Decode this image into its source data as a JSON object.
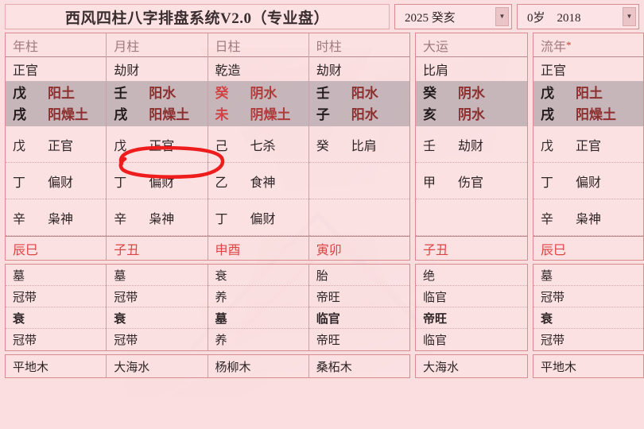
{
  "header": {
    "title": "西风四柱八字排盘系统V2.0（专业盘）",
    "year_select": {
      "value": "2025 癸亥",
      "arrow": "▼"
    },
    "age_select": {
      "value": "0岁　2018",
      "arrow": "▼"
    }
  },
  "colors": {
    "background": "#fbdfe0",
    "panel": "#fce2e3",
    "border": "#d98c90",
    "gz_band": "#b2a5aa",
    "element_text": "#8c2f2f",
    "day_master": "#d04343",
    "void_text": "#dd4444",
    "title_text": "#a07a7d",
    "annotation": "#ee1c1c"
  },
  "pillars": [
    {
      "group": "natal",
      "title": "年柱",
      "title_star": "",
      "ten_god": "正官",
      "stem": {
        "char": "戊",
        "element": "阳土",
        "is_day": false
      },
      "branch": {
        "char": "戌",
        "element": "阳燥土",
        "is_day": false
      },
      "hidden": [
        {
          "char": "戊",
          "god": "正官"
        },
        {
          "char": "丁",
          "god": "偏财"
        },
        {
          "char": "辛",
          "god": "枭神"
        }
      ],
      "void": "辰巳",
      "stages": [
        "墓",
        "冠带",
        "衰",
        "冠带"
      ],
      "stage_bold_index": 2,
      "nayin": "平地木"
    },
    {
      "group": "natal",
      "title": "月柱",
      "title_star": "",
      "ten_god": "劫财",
      "stem": {
        "char": "壬",
        "element": "阳水",
        "is_day": false
      },
      "branch": {
        "char": "戌",
        "element": "阳燥土",
        "is_day": false
      },
      "hidden": [
        {
          "char": "戊",
          "god": "正官"
        },
        {
          "char": "丁",
          "god": "偏财"
        },
        {
          "char": "辛",
          "god": "枭神"
        }
      ],
      "void": "子丑",
      "stages": [
        "墓",
        "冠带",
        "衰",
        "冠带"
      ],
      "stage_bold_index": 2,
      "nayin": "大海水"
    },
    {
      "group": "natal",
      "title": "日柱",
      "title_star": "",
      "ten_god": "乾造",
      "stem": {
        "char": "癸",
        "element": "阴水",
        "is_day": true
      },
      "branch": {
        "char": "未",
        "element": "阴燥土",
        "is_day": true
      },
      "hidden": [
        {
          "char": "己",
          "god": "七杀"
        },
        {
          "char": "乙",
          "god": "食神"
        },
        {
          "char": "丁",
          "god": "偏财"
        }
      ],
      "void": "申酉",
      "stages": [
        "衰",
        "养",
        "墓",
        "养"
      ],
      "stage_bold_index": 2,
      "nayin": "杨柳木"
    },
    {
      "group": "natal",
      "title": "时柱",
      "title_star": "",
      "ten_god": "劫财",
      "stem": {
        "char": "壬",
        "element": "阳水",
        "is_day": false
      },
      "branch": {
        "char": "子",
        "element": "阳水",
        "is_day": false
      },
      "hidden": [
        {
          "char": "癸",
          "god": "比肩"
        },
        {
          "char": "",
          "god": ""
        },
        {
          "char": "",
          "god": ""
        }
      ],
      "void": "寅卯",
      "stages": [
        "胎",
        "帝旺",
        "临官",
        "帝旺"
      ],
      "stage_bold_index": 2,
      "nayin": "桑柘木"
    },
    {
      "group": "luck",
      "title": "大运",
      "title_star": "",
      "ten_god": "比肩",
      "stem": {
        "char": "癸",
        "element": "阴水",
        "is_day": false
      },
      "branch": {
        "char": "亥",
        "element": "阴水",
        "is_day": false
      },
      "hidden": [
        {
          "char": "壬",
          "god": "劫财"
        },
        {
          "char": "甲",
          "god": "伤官"
        },
        {
          "char": "",
          "god": ""
        }
      ],
      "void": "子丑",
      "stages": [
        "绝",
        "临官",
        "帝旺",
        "临官"
      ],
      "stage_bold_index": 2,
      "nayin": "大海水"
    },
    {
      "group": "annual",
      "title": "流年",
      "title_star": "*",
      "ten_god": "正官",
      "stem": {
        "char": "戊",
        "element": "阳土",
        "is_day": false
      },
      "branch": {
        "char": "戌",
        "element": "阳燥土",
        "is_day": false
      },
      "hidden": [
        {
          "char": "戊",
          "god": "正官"
        },
        {
          "char": "丁",
          "god": "偏财"
        },
        {
          "char": "辛",
          "god": "枭神"
        }
      ],
      "void": "辰巳",
      "stages": [
        "墓",
        "冠带",
        "衰",
        "冠带"
      ],
      "stage_bold_index": 2,
      "nayin": "平地木"
    }
  ],
  "annotation": {
    "shape": "hand-drawn-red-ellipse",
    "target": "月柱 hidden stem 戊 正官"
  }
}
